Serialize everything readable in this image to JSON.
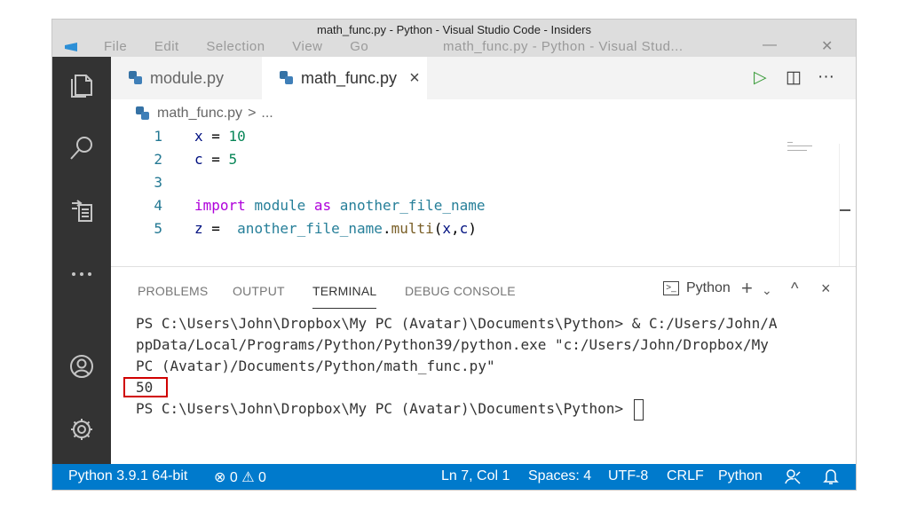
{
  "window": {
    "title": "math_func.py - Python - Visual Studio Code - Insiders",
    "ghost_menu": [
      "File",
      "Edit",
      "Selection",
      "View",
      "Go"
    ],
    "ghost_title": "math_func.py - Python - Visual Stud..."
  },
  "activity_bar": [
    "explorer-icon",
    "search-icon",
    "source-control-icon",
    "more-icon",
    "account-icon",
    "settings-gear-icon"
  ],
  "tabs": [
    {
      "label": "module.py",
      "active": false
    },
    {
      "label": "math_func.py",
      "active": true,
      "close": "×"
    }
  ],
  "tab_actions": {
    "run": "▷",
    "split": "◫",
    "more": "···"
  },
  "breadcrumb": {
    "file": "math_func.py",
    "sep": ">",
    "rest": "..."
  },
  "code": {
    "lines": [
      {
        "n": "1",
        "tokens": [
          [
            "var",
            "x"
          ],
          [
            "op",
            " = "
          ],
          [
            "num",
            "10"
          ]
        ]
      },
      {
        "n": "2",
        "tokens": [
          [
            "var",
            "c"
          ],
          [
            "op",
            " = "
          ],
          [
            "num",
            "5"
          ]
        ]
      },
      {
        "n": "3",
        "tokens": []
      },
      {
        "n": "4",
        "tokens": [
          [
            "kw",
            "import"
          ],
          [
            "op",
            " "
          ],
          [
            "ns",
            "module"
          ],
          [
            "op",
            " "
          ],
          [
            "kw",
            "as"
          ],
          [
            "op",
            " "
          ],
          [
            "ns",
            "another_file_name"
          ]
        ]
      },
      {
        "n": "5",
        "tokens": [
          [
            "var",
            "z"
          ],
          [
            "op",
            " =  "
          ],
          [
            "ns",
            "another_file_name"
          ],
          [
            "op",
            "."
          ],
          [
            "fn",
            "multi"
          ],
          [
            "op",
            "("
          ],
          [
            "var",
            "x"
          ],
          [
            "op",
            ","
          ],
          [
            "var",
            "c"
          ],
          [
            "op",
            ")"
          ]
        ]
      }
    ]
  },
  "panel": {
    "tabs": [
      "PROBLEMS",
      "OUTPUT",
      "TERMINAL",
      "DEBUG CONSOLE"
    ],
    "active_tab": "TERMINAL",
    "terminal_profile": "Python",
    "actions": {
      "add": "+",
      "dropdown": "⌄",
      "maximize": "^",
      "close": "×"
    }
  },
  "terminal": {
    "lines": [
      "PS C:\\Users\\John\\Dropbox\\My PC (Avatar)\\Documents\\Python> & C:/Users/John/A",
      "ppData/Local/Programs/Python/Python39/python.exe \"c:/Users/John/Dropbox/My",
      "PC (Avatar)/Documents/Python/math_func.py\"",
      "50",
      "PS C:\\Users\\John\\Dropbox\\My PC (Avatar)\\Documents\\Python> "
    ],
    "highlighted_output": "50"
  },
  "status_bar": {
    "interpreter": "Python 3.9.1 64-bit",
    "errors": "⊗ 0",
    "warnings": "⚠ 0",
    "position": "Ln 7, Col 1",
    "spaces": "Spaces: 4",
    "encoding": "UTF-8",
    "eol": "CRLF",
    "language": "Python",
    "feedback_icon": "feedback-icon",
    "bell_icon": "bell-icon"
  },
  "colors": {
    "status_bar": "#007acc",
    "activity_bar": "#333333",
    "highlight_box": "#d00000"
  }
}
